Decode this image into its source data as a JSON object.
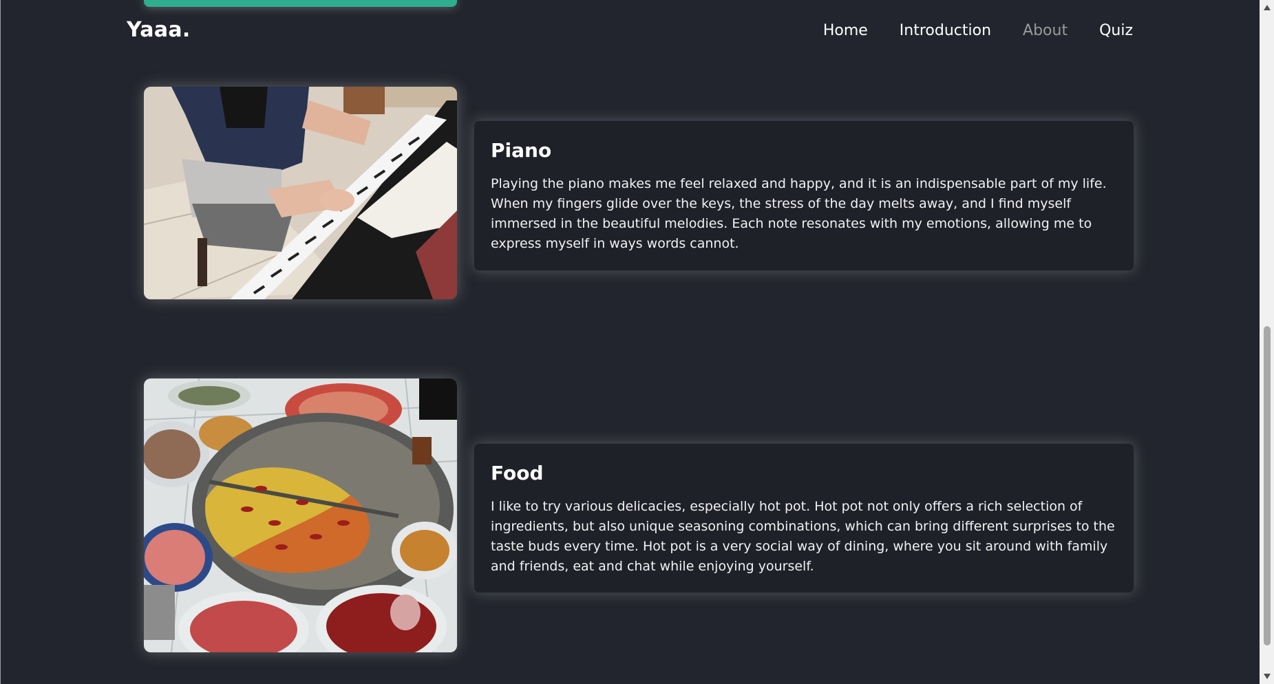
{
  "header": {
    "logo": "Yaaa.",
    "nav": [
      "Home",
      "Introduction",
      "About",
      "Quiz"
    ],
    "active_nav": "About"
  },
  "sections": [
    {
      "title": "Piano",
      "text": "Playing the piano makes me feel relaxed and happy, and it is an indispensable part of my life. When my fingers glide over the keys, the stress of the day melts away, and I find myself immersed in the beautiful melodies. Each note resonates with my emotions, allowing me to express myself in ways words cannot."
    },
    {
      "title": "Food",
      "text": "I like to try various delicacies, especially hot pot. Hot pot not only offers a rich selection of ingredients, but also unique seasoning combinations, which can bring different surprises to the taste buds every time. Hot pot is a very social way of dining, where you sit around with family and friends, eat and chat while enjoying yourself."
    }
  ],
  "colors": {
    "background": "#22252d",
    "card": "#1e2128",
    "accent_top": "#2eae8f",
    "nav_active": "#9a9a9a"
  },
  "icons": [
    "scroll-up-arrow-icon",
    "scroll-down-arrow-icon"
  ]
}
